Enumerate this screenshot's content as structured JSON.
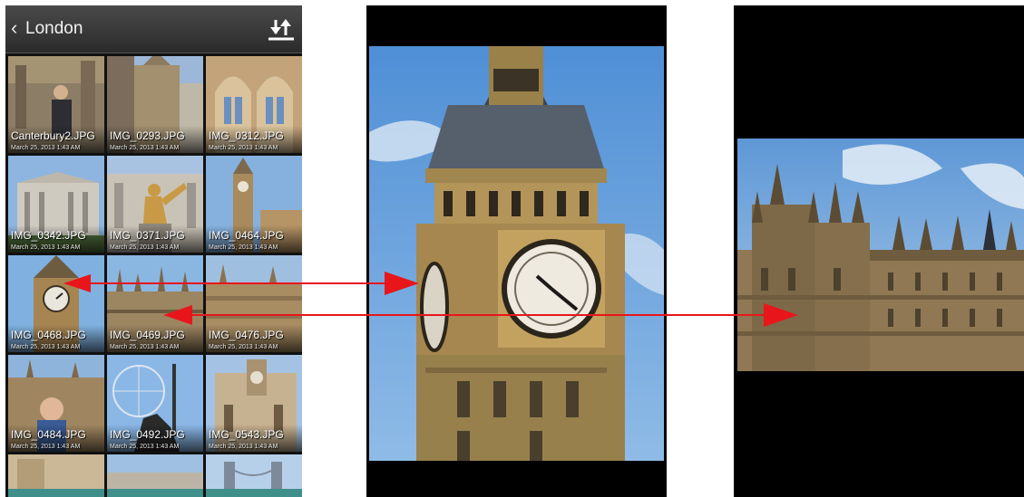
{
  "gallery": {
    "album_title": "London",
    "photos": [
      {
        "name": "Canterbury2.JPG",
        "date": "March 25, 2013 1:43 AM"
      },
      {
        "name": "IMG_0293.JPG",
        "date": "March 25, 2013 1:43 AM"
      },
      {
        "name": "IMG_0312.JPG",
        "date": "March 25, 2013 1:43 AM"
      },
      {
        "name": "IMG_0342.JPG",
        "date": "March 25, 2013 1:43 AM"
      },
      {
        "name": "IMG_0371.JPG",
        "date": "March 25, 2013 1:43 AM"
      },
      {
        "name": "IMG_0464.JPG",
        "date": "March 25, 2013 1:43 AM"
      },
      {
        "name": "IMG_0468.JPG",
        "date": "March 25, 2013 1:43 AM"
      },
      {
        "name": "IMG_0469.JPG",
        "date": "March 25, 2013 1:43 AM"
      },
      {
        "name": "IMG_0476.JPG",
        "date": "March 25, 2013 1:43 AM"
      },
      {
        "name": "IMG_0484.JPG",
        "date": "March 25, 2013 1:43 AM"
      },
      {
        "name": "IMG_0492.JPG",
        "date": "March 25, 2013 1:43 AM"
      },
      {
        "name": "IMG_0543.JPG",
        "date": "March 25, 2013 1:43 AM"
      }
    ]
  },
  "icons": {
    "back": "chevron-left-icon",
    "sort": "sort-arrows-icon"
  },
  "colors": {
    "arrow": "#e8161b",
    "sky": "#6fa3d8",
    "stone": "#b08a52",
    "topbar": "#3a3a3a"
  }
}
